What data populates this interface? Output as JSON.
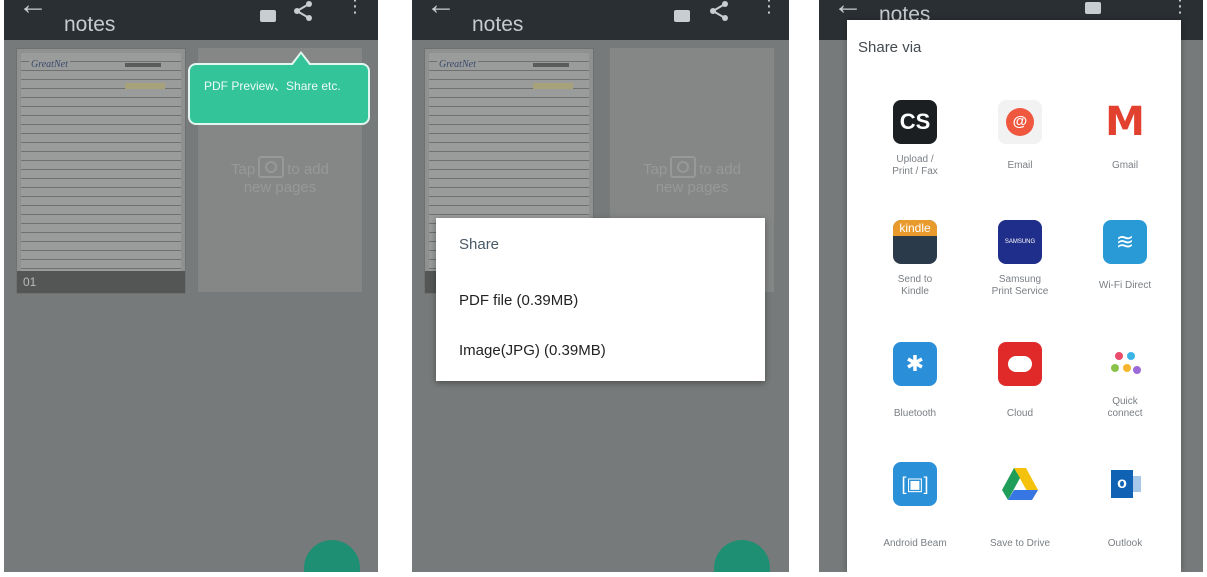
{
  "screen1": {
    "title": "notes",
    "page_number": "01",
    "tooltip": "PDF Preview、Share etc.",
    "add_pages_text_a": "Tap",
    "add_pages_text_b": "to add",
    "add_pages_text_c": "new pages"
  },
  "screen2": {
    "title": "notes",
    "add_pages_text_a": "Tap",
    "add_pages_text_b": "to add",
    "add_pages_text_c": "new pages",
    "dialog": {
      "title": "Share",
      "options": [
        "PDF file (0.39MB)",
        "Image(JPG) (0.39MB)"
      ]
    }
  },
  "screen3": {
    "title": "notes",
    "sheet_title": "Share via",
    "apps": [
      {
        "icon": "cs-icon",
        "label_a": "Upload /",
        "label_b": "Print / Fax",
        "glyph": "CS"
      },
      {
        "icon": "email-icon",
        "label_a": "Email",
        "label_b": "",
        "glyph": "@"
      },
      {
        "icon": "gmail-icon",
        "label_a": "Gmail",
        "label_b": "",
        "glyph": "M"
      },
      {
        "icon": "kindle-icon",
        "label_a": "Send to",
        "label_b": "Kindle",
        "glyph": "kindle"
      },
      {
        "icon": "samsung-print-icon",
        "label_a": "Samsung",
        "label_b": "Print Service",
        "glyph": "SAMSUNG"
      },
      {
        "icon": "wifi-direct-icon",
        "label_a": "Wi-Fi Direct",
        "label_b": "",
        "glyph": "≋"
      },
      {
        "icon": "bluetooth-icon",
        "label_a": "Bluetooth",
        "label_b": "",
        "glyph": "✱"
      },
      {
        "icon": "cloud-icon",
        "label_a": "Cloud",
        "label_b": "",
        "glyph": ""
      },
      {
        "icon": "quick-connect-icon",
        "label_a": "Quick",
        "label_b": "connect",
        "glyph": ""
      },
      {
        "icon": "android-beam-icon",
        "label_a": "Android Beam",
        "label_b": "",
        "glyph": "[▣]"
      },
      {
        "icon": "google-drive-icon",
        "label_a": "Save to Drive",
        "label_b": "",
        "glyph": ""
      },
      {
        "icon": "outlook-icon",
        "label_a": "Outlook",
        "label_b": "",
        "glyph": "o"
      }
    ]
  },
  "colors": {
    "appbar": "#2a2f33",
    "accent_green": "#33c49a",
    "fab": "#1f8f74",
    "dim_background": "#777a7a"
  }
}
